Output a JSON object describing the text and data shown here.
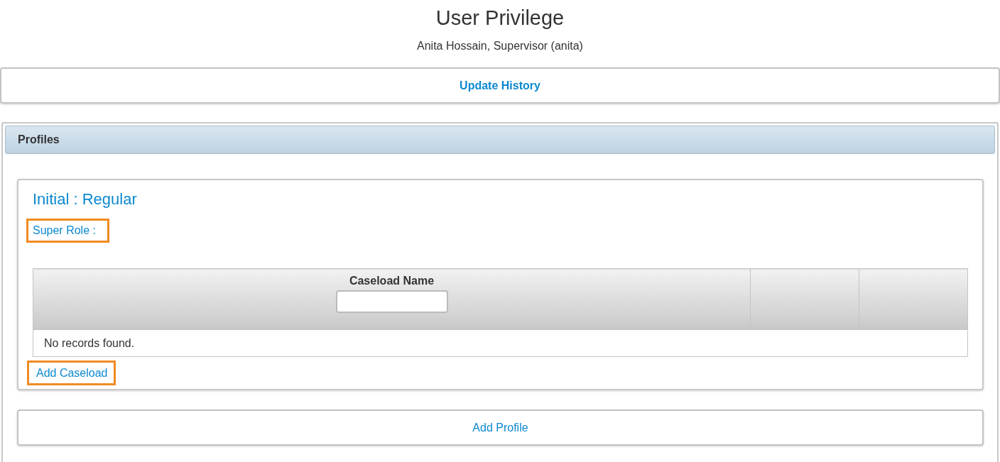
{
  "page": {
    "title": "User Privilege",
    "subtitle": "Anita Hossain, Supervisor (anita)"
  },
  "update_history": {
    "label": "Update History"
  },
  "profiles": {
    "header": "Profiles",
    "cards": [
      {
        "title": "Initial : Regular",
        "super_role": {
          "label": "Super Role :",
          "highlighted": true
        },
        "table": {
          "columns": [
            {
              "kind": "filter",
              "label": "Caseload Name"
            },
            {
              "kind": "plain"
            },
            {
              "kind": "plain"
            }
          ],
          "empty_message": "No records found."
        },
        "add_caseload": {
          "label": "Add Caseload",
          "highlighted": true
        }
      }
    ],
    "add_profile": {
      "label": "Add Profile"
    }
  }
}
